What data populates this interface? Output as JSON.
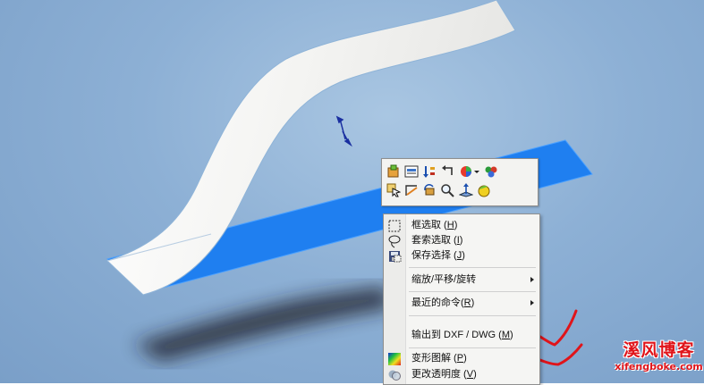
{
  "viewport": {
    "background_color": "#8fb2d6"
  },
  "colors": {
    "plane_blue": "#1f7ff0",
    "surface_white": "#ffffff",
    "annotation_red": "#e0141a"
  },
  "hud_toolbar": {
    "items": [
      {
        "icon": "view-orientation-icon"
      },
      {
        "icon": "display-style-icon"
      },
      {
        "icon": "sort-icon"
      },
      {
        "icon": "undo-icon"
      },
      {
        "icon": "appearance-icon"
      },
      {
        "icon": "scene-icon"
      },
      {
        "icon": "select-icon"
      },
      {
        "icon": "sketch-icon"
      },
      {
        "icon": "rotate-icon"
      },
      {
        "icon": "zoom-icon"
      },
      {
        "icon": "normal-to-icon"
      },
      {
        "icon": "shaded-icon"
      }
    ]
  },
  "context_menu": {
    "items": [
      {
        "label": "框选取",
        "shortcut": "H",
        "icon": "box-select-icon"
      },
      {
        "label": "套索选取",
        "shortcut": "I",
        "icon": "lasso-select-icon"
      },
      {
        "label": "保存选择",
        "shortcut": "J",
        "icon": "save-selection-icon"
      },
      {
        "label": "缩放/平移/旋转",
        "shortcut": "",
        "icon": "",
        "submenu": true
      },
      {
        "label": "最近的命令",
        "shortcut": "R",
        "icon": "",
        "submenu": true
      },
      {
        "label": "输出到 DXF / DWG",
        "shortcut": "M",
        "icon": ""
      },
      {
        "label": "变形图解",
        "shortcut": "P",
        "icon": "deformation-plot-icon"
      },
      {
        "label": "更改透明度",
        "shortcut": "V",
        "icon": "transparency-icon"
      }
    ]
  },
  "watermark": {
    "name": "溪风博客",
    "url": "xifengboke.com"
  }
}
